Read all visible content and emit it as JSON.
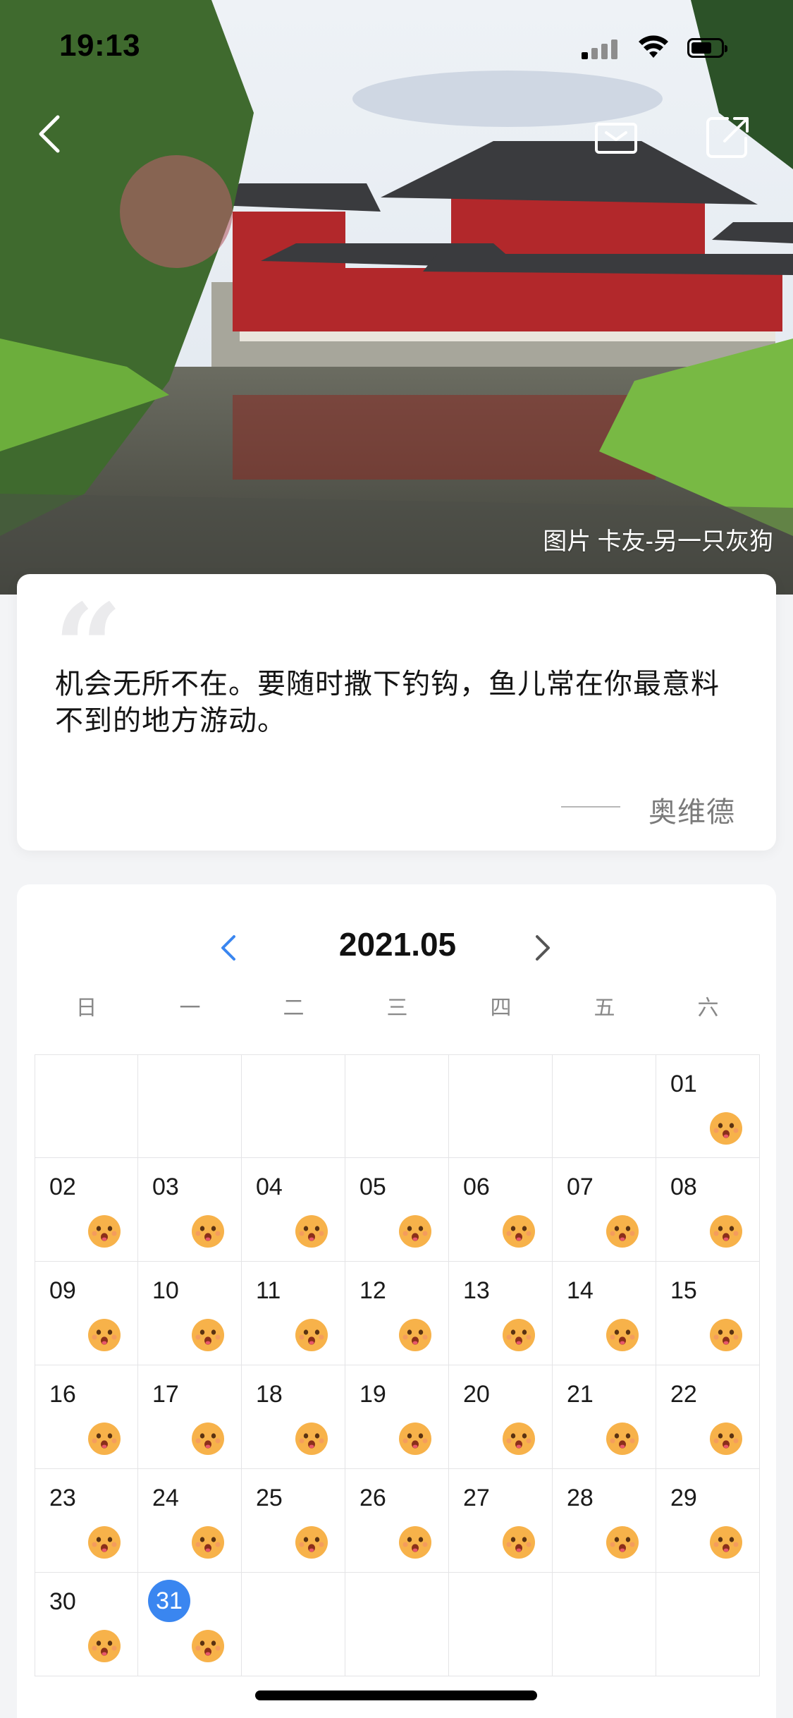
{
  "status_bar": {
    "time": "19:13"
  },
  "hero": {
    "photo_credit": "图片 卡友-另一只灰狗"
  },
  "quote": {
    "text": "机会无所不在。要随时撒下钓钩，鱼儿常在你最意料不到的地方游动。",
    "author_dash": "——",
    "author": "奥维德"
  },
  "calendar": {
    "title": "2021.05",
    "today": "31",
    "weekdays": [
      "日",
      "一",
      "二",
      "三",
      "四",
      "五",
      "六"
    ],
    "weeks": [
      [
        "",
        "",
        "",
        "",
        "",
        "",
        "01"
      ],
      [
        "02",
        "03",
        "04",
        "05",
        "06",
        "07",
        "08"
      ],
      [
        "09",
        "10",
        "11",
        "12",
        "13",
        "14",
        "15"
      ],
      [
        "16",
        "17",
        "18",
        "19",
        "20",
        "21",
        "22"
      ],
      [
        "23",
        "24",
        "25",
        "26",
        "27",
        "28",
        "29"
      ],
      [
        "30",
        "31",
        "",
        "",
        "",
        "",
        ""
      ]
    ]
  },
  "icons": {
    "back": "chevron-left-icon",
    "subscribe": "mail-icon",
    "share": "share-icon",
    "mood": "smiling-face-icon"
  },
  "colors": {
    "accent": "#3a86f0",
    "mood_face": "#f7b24a"
  }
}
